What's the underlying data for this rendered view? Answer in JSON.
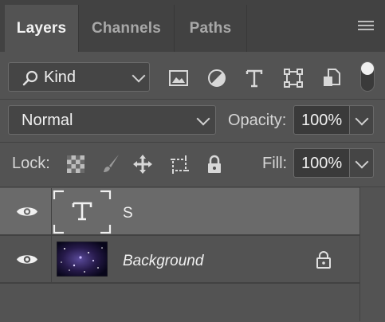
{
  "tabs": [
    {
      "label": "Layers",
      "active": true
    },
    {
      "label": "Channels",
      "active": false
    },
    {
      "label": "Paths",
      "active": false
    }
  ],
  "filter": {
    "kind_label": "Kind",
    "icons": [
      "image-filter-icon",
      "adjustment-filter-icon",
      "type-filter-icon",
      "shape-filter-icon",
      "smart-object-filter-icon"
    ],
    "toggle_on": true
  },
  "blend": {
    "mode": "Normal",
    "opacity_label": "Opacity:",
    "opacity_value": "100%"
  },
  "lock": {
    "label": "Lock:",
    "fill_label": "Fill:",
    "fill_value": "100%"
  },
  "layers": [
    {
      "name": "S",
      "type": "text",
      "visible": true,
      "selected": true,
      "locked": false
    },
    {
      "name": "Background",
      "type": "image",
      "visible": true,
      "selected": false,
      "locked": true
    }
  ],
  "colors": {
    "panel": "#535353",
    "tabbar": "#424242",
    "selected_row": "#6a6a6a",
    "text": "#f0f0f0"
  }
}
